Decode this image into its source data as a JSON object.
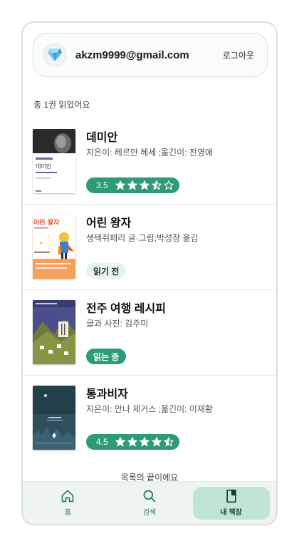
{
  "account": {
    "email": "akzm9999@gmail.com",
    "logout_label": "로그아웃",
    "avatar_icon": "diamond-icon"
  },
  "summary": {
    "count_text": "총 1권 읽었어요"
  },
  "books": [
    {
      "title": "데미안",
      "author": "지은이: 헤르만 헤세 ;옮긴이: 전영애",
      "status": "rating",
      "rating": 3.5,
      "rating_label": "3.5",
      "cover_lines": [
        "데미안"
      ]
    },
    {
      "title": "어린 왕자",
      "author": "생텍쥐페리 글·그림;박성창 옮김",
      "status": "todo",
      "status_label": "읽기 전",
      "cover_lines": [
        "어린 왕자"
      ]
    },
    {
      "title": "전주 여행 레시피",
      "author": "글과 사진: 김주미",
      "status": "reading",
      "status_label": "읽는 중",
      "cover_lines": []
    },
    {
      "title": "통과비자",
      "author": "지은이: 안나 제거스 ;옮긴이: 이재황",
      "status": "rating",
      "rating": 4.5,
      "rating_label": "4.5",
      "cover_lines": []
    }
  ],
  "list_end_text": "목록의 끝이에요",
  "nav": [
    {
      "label": "홈",
      "icon": "home-icon",
      "active": false
    },
    {
      "label": "검색",
      "icon": "search-icon",
      "active": false
    },
    {
      "label": "내 책장",
      "icon": "bookshelf-icon",
      "active": true
    }
  ],
  "colors": {
    "accent": "#2e9b77",
    "nav_bg": "#eef5f1",
    "nav_active": "#bfe6d2",
    "todo_pill": "#e8f3ec"
  }
}
